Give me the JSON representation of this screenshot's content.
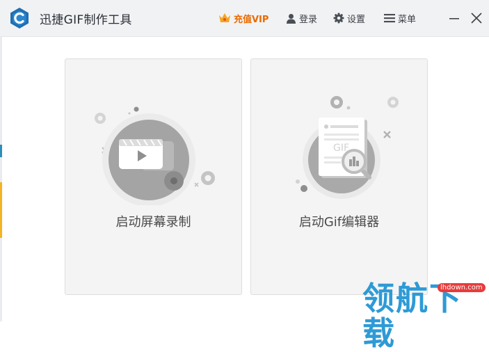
{
  "app": {
    "title": "迅捷GIF制作工具"
  },
  "toolbar": {
    "vip_label": "充值VIP",
    "login_label": "登录",
    "settings_label": "设置",
    "menu_label": "菜单"
  },
  "cards": [
    {
      "label": "启动屏幕录制",
      "icon": "video-record-icon"
    },
    {
      "label": "启动Gif编辑器",
      "icon": "gif-editor-icon"
    }
  ],
  "editor_art": {
    "doc_text": "GIF"
  },
  "watermark": {
    "text": "领航下载",
    "site": "lhdown.com"
  },
  "colors": {
    "accent": "#ea6a00",
    "logo": "#1f6fb2",
    "watermark": "#2e9ad6"
  }
}
